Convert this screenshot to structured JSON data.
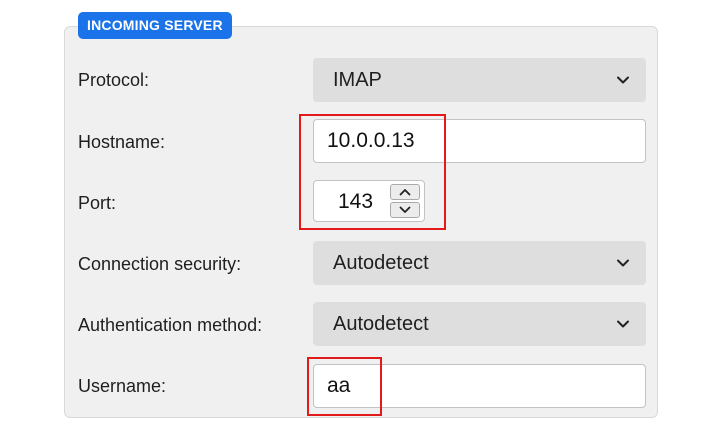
{
  "section": {
    "legend": "INCOMING SERVER"
  },
  "fields": {
    "protocol": {
      "label": "Protocol:",
      "value": "IMAP",
      "icon": "chevron-down-icon"
    },
    "hostname": {
      "label": "Hostname:",
      "value": "10.0.0.13"
    },
    "port": {
      "label": "Port:",
      "value": "143",
      "up_icon": "chevron-up-icon",
      "down_icon": "chevron-down-icon"
    },
    "connection_security": {
      "label": "Connection security:",
      "value": "Autodetect",
      "icon": "chevron-down-icon"
    },
    "authentication_method": {
      "label": "Authentication method:",
      "value": "Autodetect",
      "icon": "chevron-down-icon"
    },
    "username": {
      "label": "Username:",
      "value": "aa"
    }
  },
  "colors": {
    "legend_bg": "#1a73e8",
    "highlight": "#e11b1b",
    "select_bg": "#dedede",
    "panel_bg": "#f0f0f0"
  }
}
